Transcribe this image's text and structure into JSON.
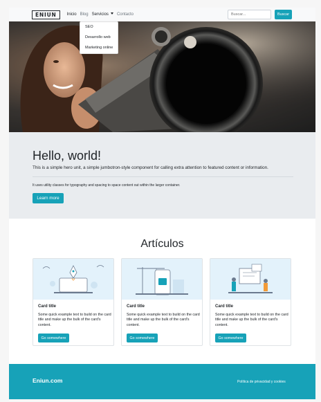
{
  "navbar": {
    "brand": "ENIUN",
    "links": [
      {
        "label": "Inicio"
      },
      {
        "label": "Blog"
      },
      {
        "label": "Servicios"
      },
      {
        "label": "Contacto"
      }
    ],
    "search": {
      "placeholder": "Buscar...",
      "button_label": "Buscar"
    }
  },
  "dropdown": {
    "items": [
      "SEO",
      "Desarrollo web",
      "Marketing online"
    ]
  },
  "jumbotron": {
    "title": "Hello, world!",
    "lead": "This is a simple hero unit, a simple jumbotron-style component for calling extra attention to featured content or information.",
    "text": "It uses utility classes for typography and spacing to space content out within the larger container.",
    "button_label": "Learn more"
  },
  "articles": {
    "title": "Artículos",
    "cards": [
      {
        "title": "Card title",
        "text": "Some quick example text to build on the card title and make up the bulk of the card's content.",
        "button_label": "Go somewhere"
      },
      {
        "title": "Card title",
        "text": "Some quick example text to build on the card title and make up the bulk of the card's content.",
        "button_label": "Go somewhere"
      },
      {
        "title": "Card title",
        "text": "Some quick example text to build on the card title and make up the bulk of the card's content.",
        "button_label": "Go somewhere"
      }
    ]
  },
  "footer": {
    "brand": "Eniun.com",
    "link": "Política de privacidad y cookies"
  },
  "colors": {
    "accent": "#17a2b8",
    "navbar_bg": "#f8f9fa",
    "jumbotron_bg": "#e9ecef",
    "card_image_bg": "#e3f2fb"
  }
}
